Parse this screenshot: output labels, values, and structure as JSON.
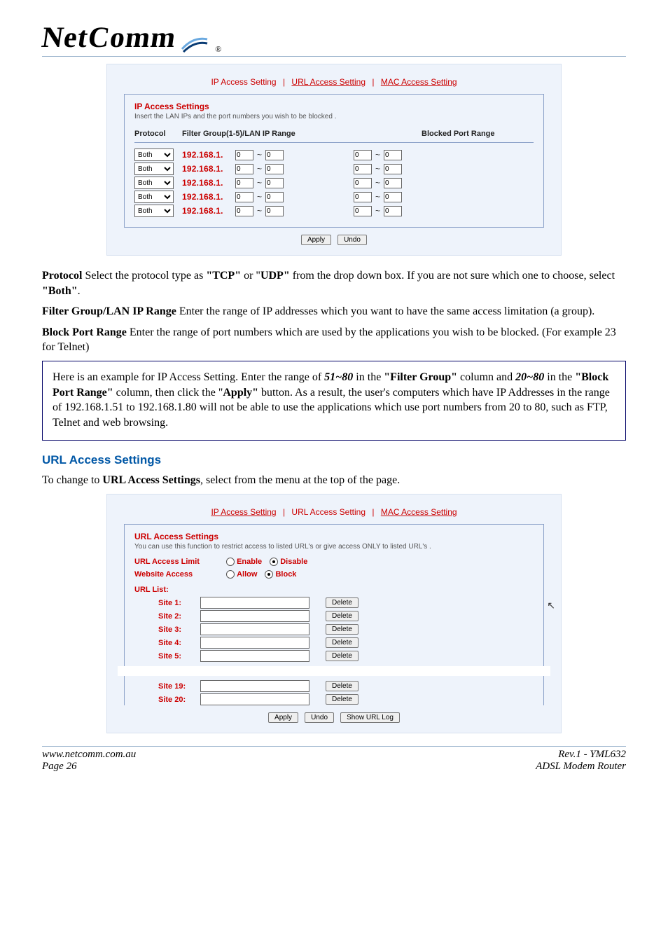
{
  "brand": "NetComm",
  "tabs": {
    "ip": "IP Access Setting",
    "url": "URL Access Setting",
    "mac": "MAC Access Setting"
  },
  "ipPanel": {
    "title": "IP Access Settings",
    "subtitle": "Insert the LAN IPs and the port numbers you wish to be blocked .",
    "headers": {
      "protocol": "Protocol",
      "filter": "Filter Group(1-5)/LAN IP Range",
      "blocked": "Blocked Port Range"
    },
    "protoOption": "Both",
    "ipPrefix": "192.168.1.",
    "rows": [
      {
        "ip_a": "0",
        "ip_b": "0",
        "p_a": "0",
        "p_b": "0"
      },
      {
        "ip_a": "0",
        "ip_b": "0",
        "p_a": "0",
        "p_b": "0"
      },
      {
        "ip_a": "0",
        "ip_b": "0",
        "p_a": "0",
        "p_b": "0"
      },
      {
        "ip_a": "0",
        "ip_b": "0",
        "p_a": "0",
        "p_b": "0"
      },
      {
        "ip_a": "0",
        "ip_b": "0",
        "p_a": "0",
        "p_b": "0"
      }
    ],
    "buttons": {
      "apply": "Apply",
      "undo": "Undo"
    }
  },
  "body": {
    "protocol_label": "Protocol",
    "protocol_text1": " Select the protocol type as ",
    "protocol_tcp": "\"TCP\"",
    "protocol_or": " or \"",
    "protocol_udp": "UDP\"",
    "protocol_text2": " from the drop down box. If you are not sure which one to choose, select ",
    "protocol_both": "\"Both\"",
    "protocol_period": ".",
    "filter_label": "Filter Group/LAN IP Range",
    "filter_text": " Enter the range of IP addresses which you want to have the same access limitation (a group).",
    "block_label": "Block Port Range",
    "block_text1": " Enter the range of port numbers which are used by the applications you wish to be blocked.  (For example 23 for Telnet)",
    "example_1": "Here is an example for IP Access Setting. Enter the range of ",
    "example_51_80": "51~80",
    "example_2": " in the ",
    "example_fg": "\"Filter Group\"",
    "example_3": " column and ",
    "example_20_80": "20~80",
    "example_4": " in the ",
    "example_bpr": "\"Block Port Range\"",
    "example_5": " column, then click the \"",
    "example_apply": "Apply\"",
    "example_6": " button. As a result, the user's computers which have IP Addresses in the range of 192.168.1.51 to 192.168.1.80 will not be able to use the applications which use port numbers from 20 to 80, such as FTP, Telnet and web browsing.",
    "url_heading": "URL Access Settings",
    "url_intro_a": "To change to ",
    "url_intro_b": "URL Access Settings",
    "url_intro_c": ", select from the menu at the top of the page."
  },
  "urlPanel": {
    "title": "URL Access Settings",
    "subtitle": "You can use this function to restrict access to listed URL's or give access ONLY to listed URL's .",
    "accessLimitLabel": "URL Access Limit",
    "enable": "Enable",
    "disable": "Disable",
    "websiteAccessLabel": "Website Access",
    "allow": "Allow",
    "block": "Block",
    "listTitle": "URL List:",
    "sitesTop": [
      {
        "label": "Site 1:"
      },
      {
        "label": "Site 2:"
      },
      {
        "label": "Site 3:"
      },
      {
        "label": "Site 4:"
      },
      {
        "label": "Site 5:"
      }
    ],
    "sitesBottom": [
      {
        "label": "Site 19:"
      },
      {
        "label": "Site 20:"
      }
    ],
    "deleteBtn": "Delete",
    "buttons": {
      "apply": "Apply",
      "undo": "Undo",
      "showlog": "Show URL Log"
    }
  },
  "footer": {
    "url": "www.netcomm.com.au",
    "page": "Page 26",
    "rev": "Rev.1 - YML632",
    "product": "ADSL Modem Router"
  }
}
